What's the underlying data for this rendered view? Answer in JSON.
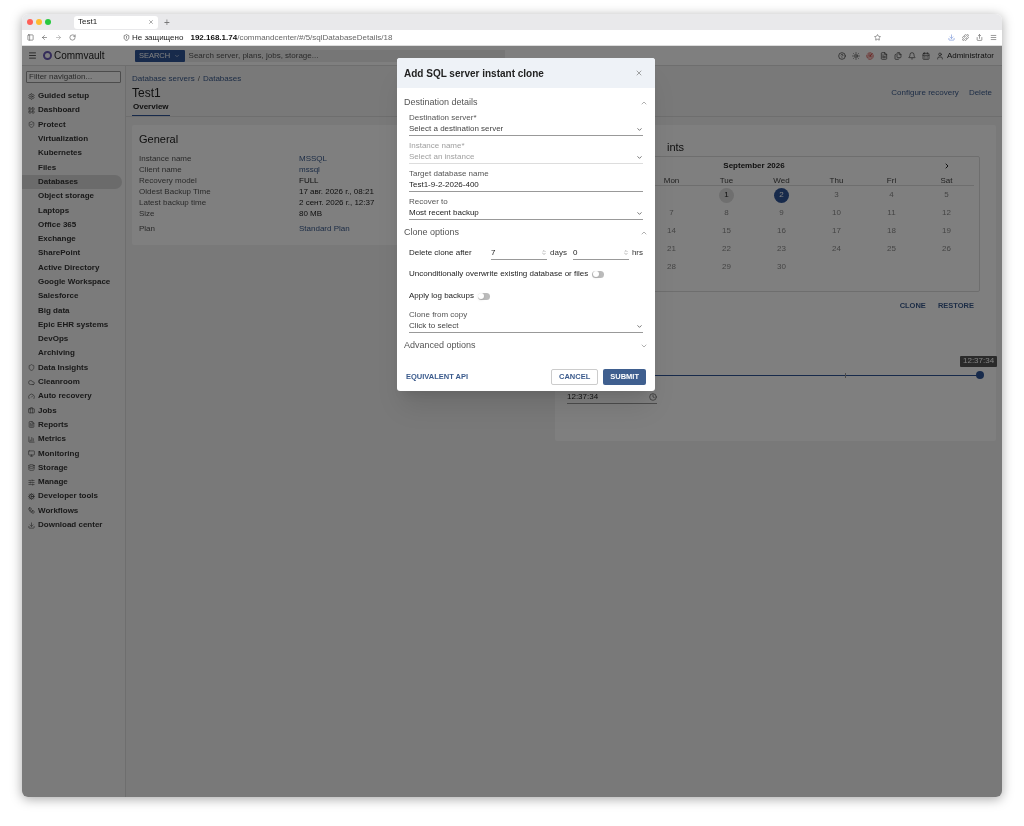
{
  "browser": {
    "tab_title": "Test1",
    "new_tab": "+",
    "security": "Не защищено",
    "url_host": "192.168.1.74",
    "url_path": "/commandcenter/#/5/sqlDatabaseDetails/18"
  },
  "header": {
    "logo": "Commvault",
    "search_button": "SEARCH",
    "search_placeholder": "Search server, plans, jobs, storage...",
    "user": "Administrator"
  },
  "sidebar": {
    "filter_placeholder": "Filter navigation...",
    "items": [
      {
        "label": "Guided setup",
        "selected": false
      },
      {
        "label": "Dashboard",
        "selected": false
      },
      {
        "label": "Protect",
        "selected": false,
        "children": [
          {
            "label": "Virtualization",
            "selected": false
          },
          {
            "label": "Kubernetes",
            "selected": false
          },
          {
            "label": "Files",
            "selected": false
          },
          {
            "label": "Databases",
            "selected": true
          },
          {
            "label": "Object storage",
            "selected": false
          },
          {
            "label": "Laptops",
            "selected": false
          },
          {
            "label": "Office 365",
            "selected": false
          },
          {
            "label": "Exchange",
            "selected": false
          },
          {
            "label": "SharePoint",
            "selected": false
          },
          {
            "label": "Active Directory",
            "selected": false
          },
          {
            "label": "Google Workspace",
            "selected": false
          },
          {
            "label": "Salesforce",
            "selected": false
          },
          {
            "label": "Big data",
            "selected": false
          },
          {
            "label": "Epic EHR systems",
            "selected": false
          },
          {
            "label": "DevOps",
            "selected": false
          },
          {
            "label": "Archiving",
            "selected": false
          }
        ]
      },
      {
        "label": "Data Insights",
        "selected": false
      },
      {
        "label": "Cleanroom",
        "selected": false
      },
      {
        "label": "Auto recovery",
        "selected": false
      },
      {
        "label": "Jobs",
        "selected": false
      },
      {
        "label": "Reports",
        "selected": false
      },
      {
        "label": "Metrics",
        "selected": false
      },
      {
        "label": "Monitoring",
        "selected": false
      },
      {
        "label": "Storage",
        "selected": false
      },
      {
        "label": "Manage",
        "selected": false
      },
      {
        "label": "Developer tools",
        "selected": false
      },
      {
        "label": "Workflows",
        "selected": false
      },
      {
        "label": "Download center",
        "selected": false
      }
    ]
  },
  "page": {
    "breadcrumb": [
      "Database servers",
      "Databases"
    ],
    "breadcrumb_separator": "/",
    "title": "Test1",
    "actions": [
      "Configure recovery",
      "Delete"
    ],
    "tabs": [
      {
        "label": "Overview",
        "selected": true
      }
    ]
  },
  "general": {
    "title": "General",
    "rows": [
      {
        "label": "Instance name",
        "value": "MSSQL",
        "link": true
      },
      {
        "label": "Client name",
        "value": "mssql",
        "link": true
      },
      {
        "label": "Recovery model",
        "value": "FULL",
        "link": false
      },
      {
        "label": "Oldest Backup Time",
        "value": "17 авг. 2026 г., 08:21",
        "link": false
      },
      {
        "label": "Latest backup time",
        "value": "2 сент. 2026 г., 12:37",
        "link": false
      },
      {
        "label": "Size",
        "value": "80 MB",
        "link": false
      },
      {
        "label": "Plan",
        "value": "Standard Plan",
        "link": true
      }
    ]
  },
  "recovery_points": {
    "title_visible": "ints",
    "calendar": {
      "month": "September 2026",
      "weekdays": [
        "Mon",
        "Tue",
        "Wed",
        "Thu",
        "Fri",
        "Sat"
      ],
      "weeks": [
        [
          {
            "kind": "empty"
          },
          {
            "kind": "day",
            "label": "1",
            "available": true,
            "selected": false
          },
          {
            "kind": "day",
            "label": "2",
            "available": true,
            "selected": true
          },
          {
            "kind": "day",
            "label": "3",
            "available": false,
            "selected": false
          },
          {
            "kind": "day",
            "label": "4",
            "available": false,
            "selected": false
          },
          {
            "kind": "day",
            "label": "5",
            "available": false,
            "selected": false
          }
        ],
        [
          {
            "kind": "day",
            "label": "7",
            "available": false,
            "selected": false
          },
          {
            "kind": "day",
            "label": "8",
            "available": false,
            "selected": false
          },
          {
            "kind": "day",
            "label": "9",
            "available": false,
            "selected": false
          },
          {
            "kind": "day",
            "label": "10",
            "available": false,
            "selected": false
          },
          {
            "kind": "day",
            "label": "11",
            "available": false,
            "selected": false
          },
          {
            "kind": "day",
            "label": "12",
            "available": false,
            "selected": false
          }
        ],
        [
          {
            "kind": "day",
            "label": "14",
            "available": false,
            "selected": false
          },
          {
            "kind": "day",
            "label": "15",
            "available": false,
            "selected": false
          },
          {
            "kind": "day",
            "label": "16",
            "available": false,
            "selected": false
          },
          {
            "kind": "day",
            "label": "17",
            "available": false,
            "selected": false
          },
          {
            "kind": "day",
            "label": "18",
            "available": false,
            "selected": false
          },
          {
            "kind": "day",
            "label": "19",
            "available": false,
            "selected": false
          }
        ],
        [
          {
            "kind": "day",
            "label": "21",
            "available": false,
            "selected": false
          },
          {
            "kind": "day",
            "label": "22",
            "available": false,
            "selected": false
          },
          {
            "kind": "day",
            "label": "23",
            "available": false,
            "selected": false
          },
          {
            "kind": "day",
            "label": "24",
            "available": false,
            "selected": false
          },
          {
            "kind": "day",
            "label": "25",
            "available": false,
            "selected": false
          },
          {
            "kind": "day",
            "label": "26",
            "available": false,
            "selected": false
          }
        ],
        [
          {
            "kind": "day",
            "label": "28",
            "available": false,
            "selected": false
          },
          {
            "kind": "day",
            "label": "29",
            "available": false,
            "selected": false
          },
          {
            "kind": "day",
            "label": "30",
            "available": false,
            "selected": false
          }
        ]
      ]
    },
    "actions": [
      "CLONE",
      "RESTORE"
    ],
    "slider": {
      "level": 1,
      "tooltip": "12:37:34"
    },
    "time_field": {
      "value": "12:37:34"
    }
  },
  "dialog": {
    "title": "Add SQL server instant clone",
    "sections": [
      {
        "title": "Destination details",
        "expanded": true,
        "fields": [
          {
            "kind": "select",
            "label": "Destination server*",
            "placeholder": "Select a destination server",
            "disabled": false
          },
          {
            "kind": "select",
            "label": "Instance name*",
            "placeholder": "Select an instance",
            "disabled": true
          },
          {
            "kind": "text",
            "label": "Target database name",
            "value": "Test1-9-2-2026-400",
            "disabled": false
          },
          {
            "kind": "select",
            "label": "Recover to",
            "value": "Most recent backup",
            "disabled": false
          }
        ]
      },
      {
        "title": "Clone options",
        "expanded": true,
        "fields": [
          {
            "kind": "duration",
            "label": "Delete clone after",
            "days": "7",
            "days_unit": "days",
            "hours": "0",
            "hours_unit": "hrs",
            "disabled": false
          },
          {
            "kind": "toggle",
            "label": "Unconditionally overwrite existing database or files",
            "on": false,
            "disabled": false
          },
          {
            "kind": "toggle",
            "label": "Apply log backups",
            "on": false,
            "disabled": false
          },
          {
            "kind": "select",
            "label": "Clone from copy",
            "placeholder": "Click to select",
            "disabled": false
          }
        ]
      },
      {
        "title": "Advanced options",
        "expanded": false
      }
    ],
    "link": "EQUIVALENT API",
    "buttons": [
      "CANCEL",
      "SUBMIT"
    ]
  }
}
